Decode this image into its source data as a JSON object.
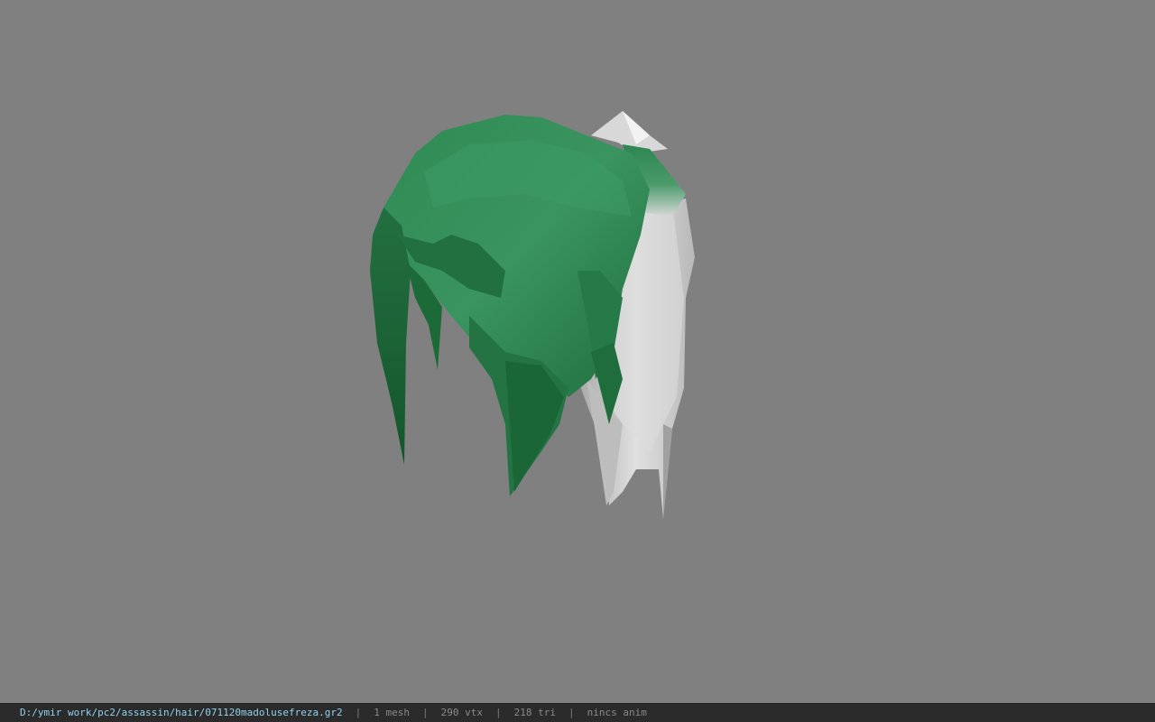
{
  "viewport": {
    "background_color": "#808080",
    "model": {
      "hair_color": "#2e8a50",
      "ponytail_color": "#d0d0d0"
    }
  },
  "statusbar": {
    "file_path": "D:/ymir work/pc2/assassin/hair/071120madolusefreza.gr2",
    "separator": "|",
    "mesh_count": "1 mesh",
    "vertex_count": "290 vtx",
    "triangle_count": "218 tri",
    "anim_status": "nincs anim",
    "path_color": "#8fd3f0"
  }
}
